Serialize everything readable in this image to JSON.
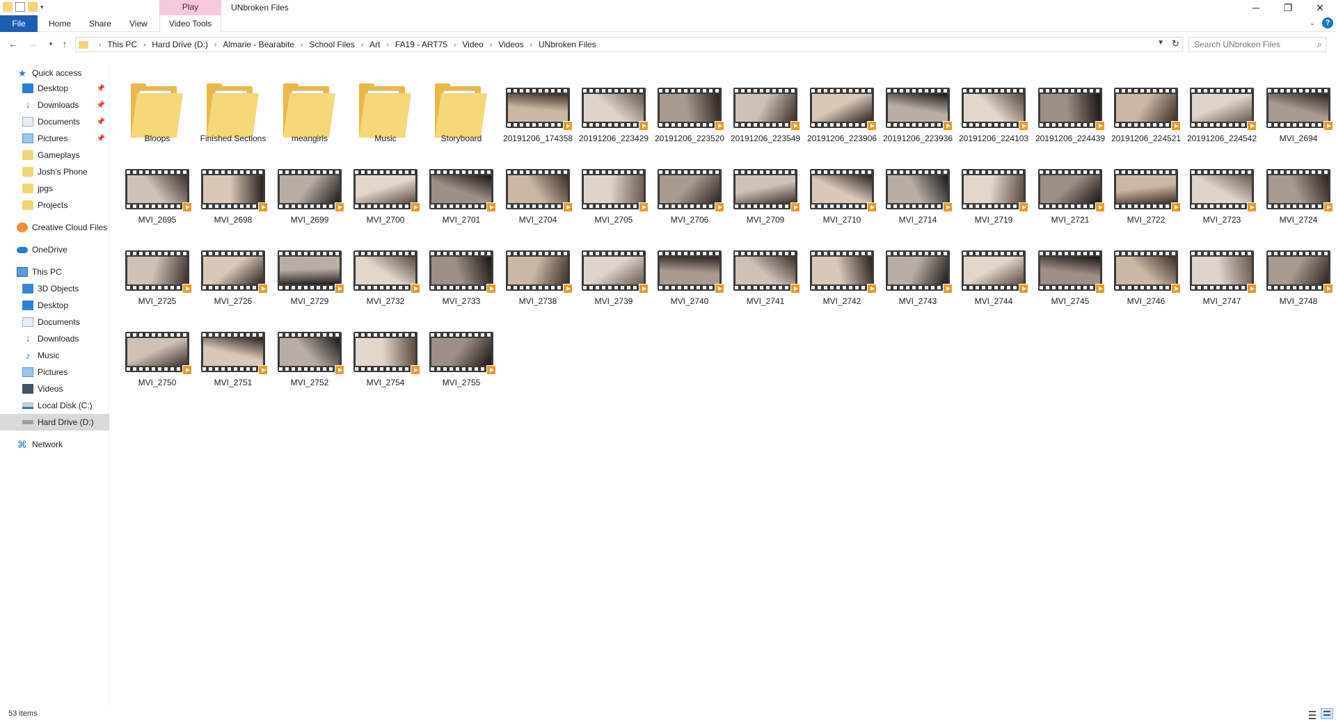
{
  "window": {
    "title": "UNbroken Files",
    "context_tab": "Play"
  },
  "ribbon": {
    "tabs": [
      "File",
      "Home",
      "Share",
      "View"
    ],
    "context_tab_label": "Video Tools"
  },
  "nav_icons": {
    "back": "back-arrow-icon",
    "forward": "forward-arrow-icon",
    "recent": "chevron-down-icon",
    "up": "up-arrow-icon"
  },
  "address": {
    "breadcrumbs": [
      "This PC",
      "Hard Drive (D:)",
      "Almarie - Bearabite",
      "School Files",
      "Art",
      "FA19 - ART75",
      "Video",
      "Videos",
      "UNbroken Files"
    ]
  },
  "search": {
    "placeholder": "Search UNbroken Files"
  },
  "sidebar": {
    "items": [
      {
        "label": "Quick access",
        "icon": "star-icon",
        "pinned": false
      },
      {
        "label": "Desktop",
        "icon": "desktop-icon",
        "pinned": true
      },
      {
        "label": "Downloads",
        "icon": "download-icon",
        "pinned": true
      },
      {
        "label": "Documents",
        "icon": "documents-icon",
        "pinned": true
      },
      {
        "label": "Pictures",
        "icon": "pictures-icon",
        "pinned": true
      },
      {
        "label": "Gameplays",
        "icon": "folder-icon",
        "pinned": false
      },
      {
        "label": "Josh's Phone",
        "icon": "folder-icon",
        "pinned": false
      },
      {
        "label": "jpgs",
        "icon": "folder-icon",
        "pinned": false
      },
      {
        "label": "Projects",
        "icon": "folder-icon",
        "pinned": false
      },
      {
        "label": "Creative Cloud Files",
        "icon": "creative-cloud-icon",
        "pinned": false
      },
      {
        "label": "OneDrive",
        "icon": "onedrive-icon",
        "pinned": false
      },
      {
        "label": "This PC",
        "icon": "pc-icon",
        "pinned": false
      },
      {
        "label": "3D Objects",
        "icon": "3d-objects-icon",
        "pinned": false
      },
      {
        "label": "Desktop",
        "icon": "desktop-icon",
        "pinned": false
      },
      {
        "label": "Documents",
        "icon": "documents-icon",
        "pinned": false
      },
      {
        "label": "Downloads",
        "icon": "download-icon",
        "pinned": false
      },
      {
        "label": "Music",
        "icon": "music-icon",
        "pinned": false
      },
      {
        "label": "Pictures",
        "icon": "pictures-icon",
        "pinned": false
      },
      {
        "label": "Videos",
        "icon": "videos-icon",
        "pinned": false
      },
      {
        "label": "Local Disk (C:)",
        "icon": "local-disk-icon",
        "pinned": false
      },
      {
        "label": "Hard Drive (D:)",
        "icon": "hard-drive-icon",
        "pinned": false,
        "selected": true
      },
      {
        "label": "Network",
        "icon": "network-icon",
        "pinned": false
      }
    ]
  },
  "files": [
    {
      "name": "Bloops",
      "kind": "folder"
    },
    {
      "name": "Finished Sections",
      "kind": "folder"
    },
    {
      "name": "meangirls",
      "kind": "folder"
    },
    {
      "name": "Music",
      "kind": "folder"
    },
    {
      "name": "Storyboard",
      "kind": "folder"
    },
    {
      "name": "20191206_174358",
      "kind": "video"
    },
    {
      "name": "20191206_223429",
      "kind": "video"
    },
    {
      "name": "20191206_223520",
      "kind": "video"
    },
    {
      "name": "20191206_223549",
      "kind": "video"
    },
    {
      "name": "20191206_223906",
      "kind": "video"
    },
    {
      "name": "20191206_223936",
      "kind": "video"
    },
    {
      "name": "20191206_224103",
      "kind": "video"
    },
    {
      "name": "20191206_224439",
      "kind": "video"
    },
    {
      "name": "20191206_224521",
      "kind": "video"
    },
    {
      "name": "20191206_224542",
      "kind": "video"
    },
    {
      "name": "MVI_2694",
      "kind": "video"
    },
    {
      "name": "MVI_2695",
      "kind": "video"
    },
    {
      "name": "MVI_2698",
      "kind": "video"
    },
    {
      "name": "MVI_2699",
      "kind": "video"
    },
    {
      "name": "MVI_2700",
      "kind": "video"
    },
    {
      "name": "MVI_2701",
      "kind": "video"
    },
    {
      "name": "MVI_2704",
      "kind": "video"
    },
    {
      "name": "MVI_2705",
      "kind": "video"
    },
    {
      "name": "MVI_2706",
      "kind": "video"
    },
    {
      "name": "MVI_2709",
      "kind": "video"
    },
    {
      "name": "MVI_2710",
      "kind": "video"
    },
    {
      "name": "MVI_2714",
      "kind": "video"
    },
    {
      "name": "MVI_2719",
      "kind": "video"
    },
    {
      "name": "MVI_2721",
      "kind": "video"
    },
    {
      "name": "MVI_2722",
      "kind": "video"
    },
    {
      "name": "MVI_2723",
      "kind": "video"
    },
    {
      "name": "MVI_2724",
      "kind": "video"
    },
    {
      "name": "MVI_2725",
      "kind": "video"
    },
    {
      "name": "MVI_2726",
      "kind": "video"
    },
    {
      "name": "MVI_2729",
      "kind": "video"
    },
    {
      "name": "MVI_2732",
      "kind": "video"
    },
    {
      "name": "MVI_2733",
      "kind": "video"
    },
    {
      "name": "MVI_2738",
      "kind": "video"
    },
    {
      "name": "MVI_2739",
      "kind": "video"
    },
    {
      "name": "MVI_2740",
      "kind": "video"
    },
    {
      "name": "MVI_2741",
      "kind": "video"
    },
    {
      "name": "MVI_2742",
      "kind": "video"
    },
    {
      "name": "MVI_2743",
      "kind": "video"
    },
    {
      "name": "MVI_2744",
      "kind": "video"
    },
    {
      "name": "MVI_2745",
      "kind": "video"
    },
    {
      "name": "MVI_2746",
      "kind": "video"
    },
    {
      "name": "MVI_2747",
      "kind": "video"
    },
    {
      "name": "MVI_2748",
      "kind": "video"
    },
    {
      "name": "MVI_2750",
      "kind": "video"
    },
    {
      "name": "MVI_2751",
      "kind": "video"
    },
    {
      "name": "MVI_2752",
      "kind": "video"
    },
    {
      "name": "MVI_2754",
      "kind": "video"
    },
    {
      "name": "MVI_2755",
      "kind": "video"
    }
  ],
  "status": {
    "item_count": "53 items"
  },
  "colors": {
    "file_tab": "#1a5fb4",
    "play_tab": "#f7c7dc",
    "selection": "#d9d9d9",
    "folder": "#f6d77a",
    "play_badge": "#e69b2e"
  }
}
